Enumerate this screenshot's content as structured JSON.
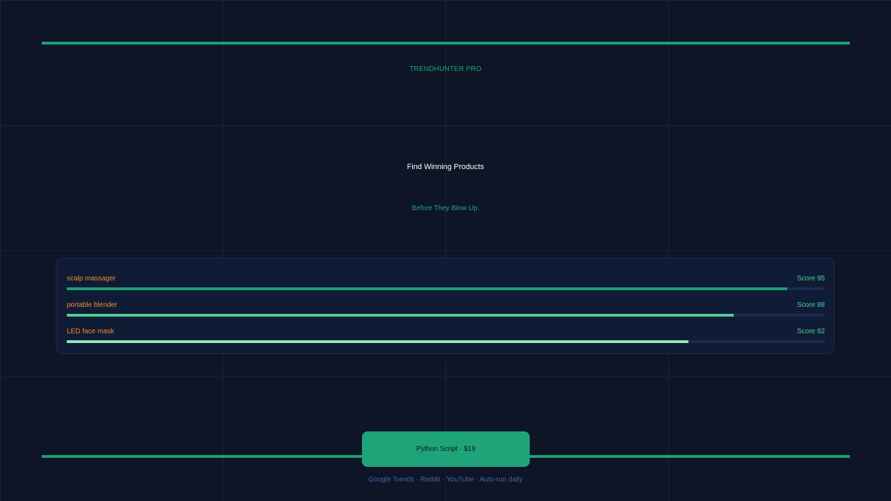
{
  "brand": {
    "name": "TRENDHUNTER PRO"
  },
  "hero": {
    "headline": "Find Winning Products",
    "subheadline": "Before They Blow Up."
  },
  "products": [
    {
      "name": "scalp massager",
      "score_label": "Score 95",
      "score": 95,
      "bar_color": "#1f9f77"
    },
    {
      "name": "portable blender",
      "score_label": "Score 88",
      "score": 88,
      "bar_color": "#4fcf9a"
    },
    {
      "name": "LED face mask",
      "score_label": "Score 82",
      "score": 82,
      "bar_color": "#8fe6c2"
    }
  ],
  "cta": {
    "label": "Python Script · $19"
  },
  "footer": {
    "sources": "Google Trends · Reddit · YouTube · Auto-run daily"
  },
  "colors": {
    "background": "#0d1526",
    "accent": "#1f9f77",
    "product_name": "#f28b2c",
    "score_text": "#4fcf9a"
  }
}
